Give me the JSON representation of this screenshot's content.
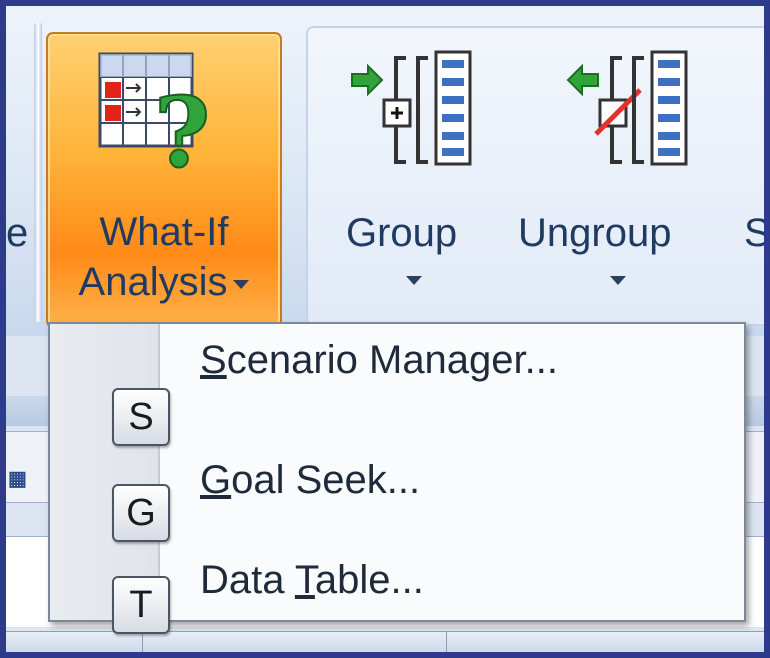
{
  "ribbon": {
    "left_partial_label": "e",
    "what_if": {
      "label_line1": "What-If",
      "label_line2": "Analysis"
    },
    "group_button": {
      "label": "Group"
    },
    "ungroup_button": {
      "label": "Ungroup"
    },
    "right_partial_label": "S"
  },
  "menu": {
    "items": [
      {
        "accel": "S",
        "label_rest": "cenario Manager...",
        "keytip": "S"
      },
      {
        "accel": "G",
        "label_rest": "oal Seek...",
        "keytip": "G"
      },
      {
        "label_pre": "Data ",
        "accel": "T",
        "label_rest": "able...",
        "keytip": "T"
      }
    ]
  },
  "colors": {
    "accent_orange": "#ff9a24",
    "frame_blue": "#2e3a8c",
    "arrow_green": "#2fa43a",
    "strike_red": "#e0322b"
  },
  "icons": {
    "what_if": "what-if-analysis-icon",
    "group": "group-icon",
    "ungroup": "ungroup-icon"
  }
}
